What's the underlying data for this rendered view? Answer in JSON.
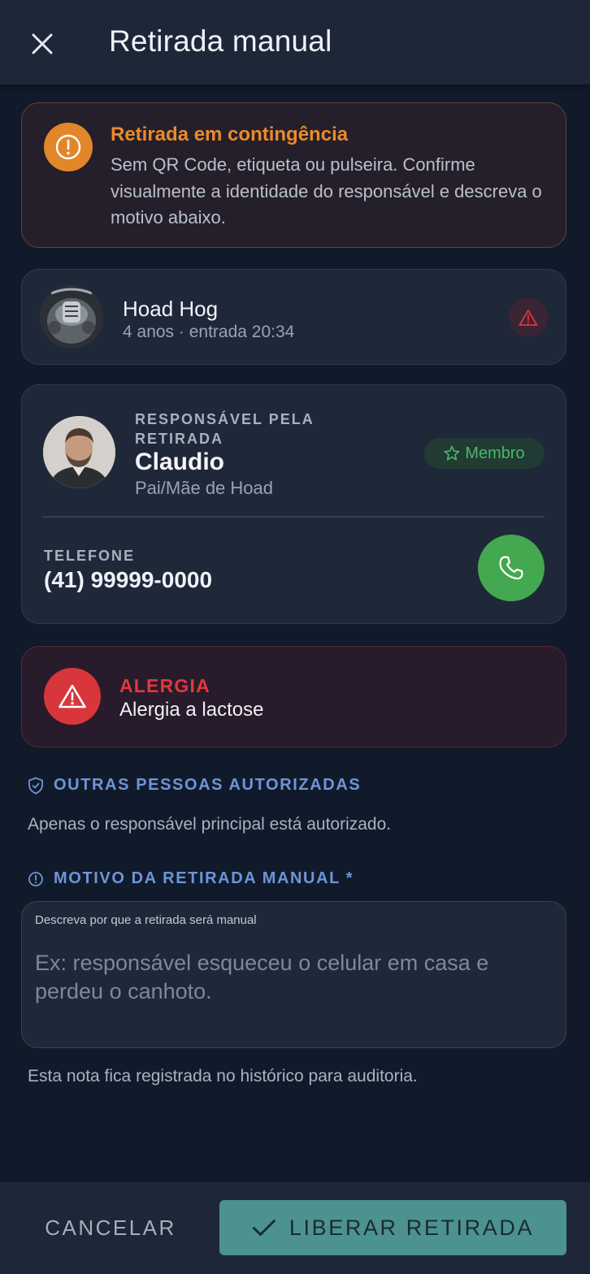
{
  "header": {
    "title": "Retirada manual",
    "close_icon": "close-icon"
  },
  "contingency": {
    "title": "Retirada em contingência",
    "text": "Sem QR Code, etiqueta ou pulseira. Confirme visualmente a identidade do responsável e descreva o motivo abaixo.",
    "icon": "info-circle-icon",
    "color": "#e2862a"
  },
  "child": {
    "name": "Hoad Hog",
    "meta": "4 anos · entrada 20:34",
    "alert_icon": "warning-triangle-icon"
  },
  "guardian": {
    "label": "RESPONSÁVEL PELA RETIRADA",
    "name": "Claudio",
    "relation": "Pai/Mãe de Hoad",
    "badge": "Membro",
    "badge_icon": "star-icon",
    "phone_label": "TELEFONE",
    "phone": "(41) 99999-0000",
    "call_color": "#43a84f"
  },
  "allergy": {
    "title": "ALERGIA",
    "text": "Alergia a lactose",
    "color": "#d8363b"
  },
  "authorized": {
    "title": "OUTRAS PESSOAS AUTORIZADAS",
    "text": "Apenas o responsável principal está autorizado."
  },
  "reason": {
    "title": "MOTIVO DA RETIRADA MANUAL *",
    "label": "Descreva por que a retirada será manual",
    "placeholder": "Ex: responsável esqueceu o celular em casa e perdeu o canhoto.",
    "value": "",
    "note": "Esta nota fica registrada no histórico para auditoria."
  },
  "footer": {
    "cancel": "CANCELAR",
    "release": "LIBERAR RETIRADA",
    "release_color": "#4c928f"
  }
}
